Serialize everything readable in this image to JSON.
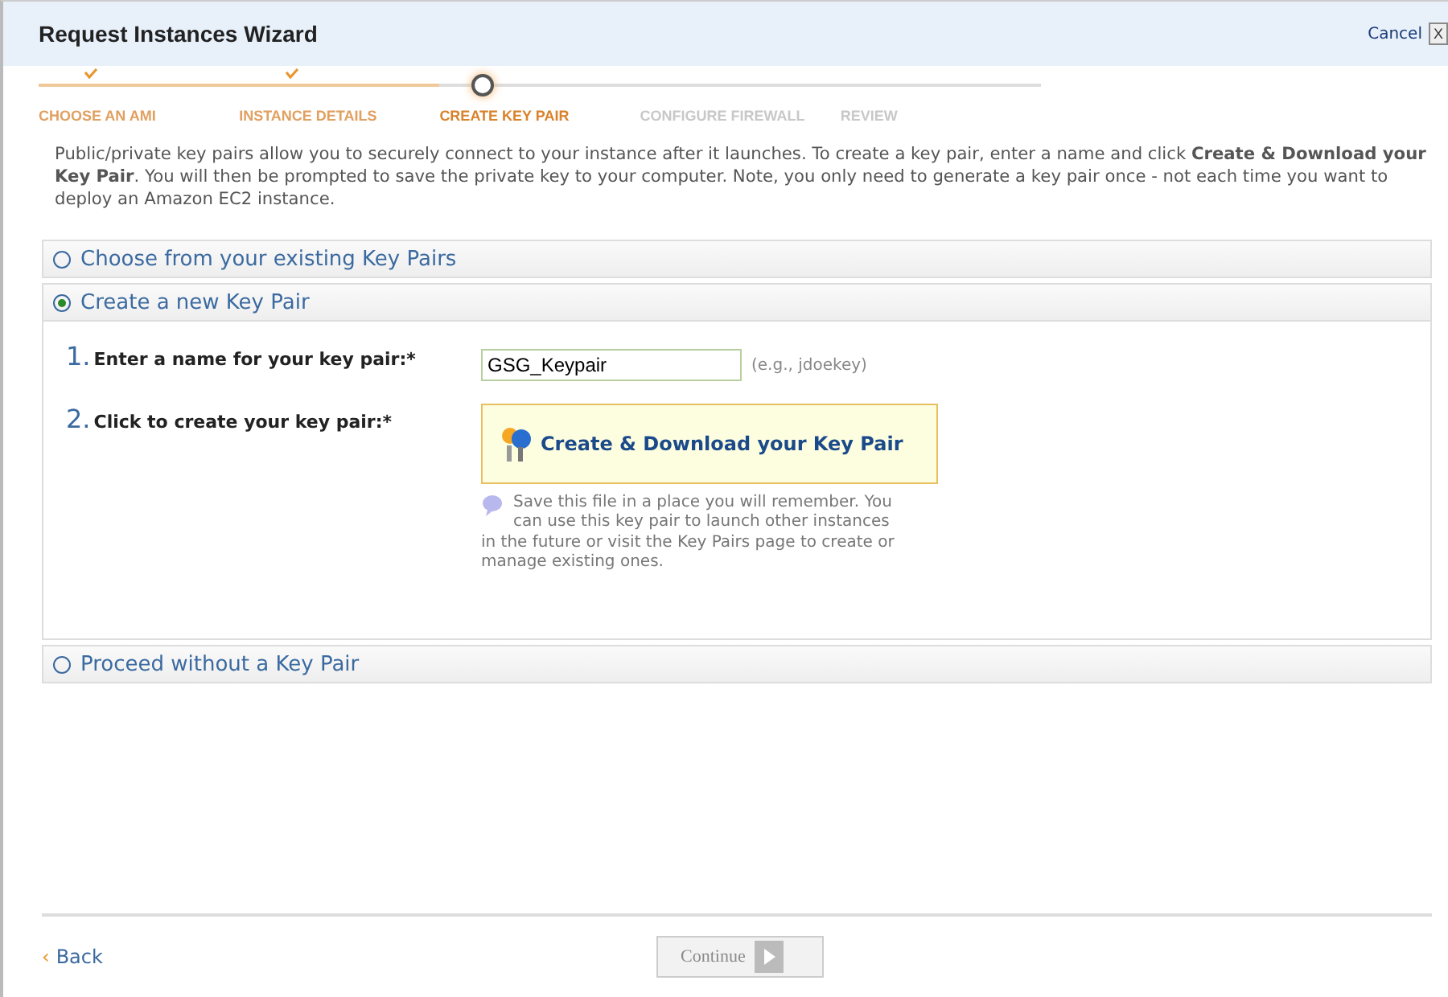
{
  "window": {
    "title": "Request Instances Wizard",
    "cancel": "Cancel",
    "close": "X"
  },
  "steps": [
    {
      "label": "CHOOSE AN AMI",
      "done": true,
      "selected": false
    },
    {
      "label": "INSTANCE DETAILS",
      "done": true,
      "selected": false
    },
    {
      "label": "CREATE KEY PAIR",
      "done": false,
      "selected": true
    },
    {
      "label": "CONFIGURE FIREWALL",
      "done": false,
      "selected": false
    },
    {
      "label": "REVIEW",
      "done": false,
      "selected": false
    }
  ],
  "intro": "Public/private key pairs allow you to securely connect to your instance after it launches. To create a key pair, enter a name and click **Create & Download your Key Pair**. You will then be prompted to save the private key to your computer. Note, you only need to generate a key pair once - not each time you want to deploy an Amazon EC2 instance.",
  "options": [
    {
      "label": "Choose from your existing Key Pairs",
      "selected": false
    },
    {
      "label": "Create a new Key Pair",
      "selected": true,
      "form": {
        "name_number": "1.",
        "name_label": "Enter a name for your key pair:*",
        "name_value": "GSG_Keypair",
        "name_hint": "(e.g., jdoekey)",
        "create_number": "2.",
        "create_label": "Click to create your key pair:*",
        "create_button": "Create & Download your Key Pair",
        "note": "Save this file in a place you will remember. You can use this key pair to launch other instances in the future or visit the Key Pairs page to create or manage existing ones."
      }
    },
    {
      "label": "Proceed without a Key Pair",
      "selected": false
    }
  ],
  "footer": {
    "back": "Back",
    "back_arrow": "‹",
    "continue": "Continue",
    "continue_disabled": true
  }
}
